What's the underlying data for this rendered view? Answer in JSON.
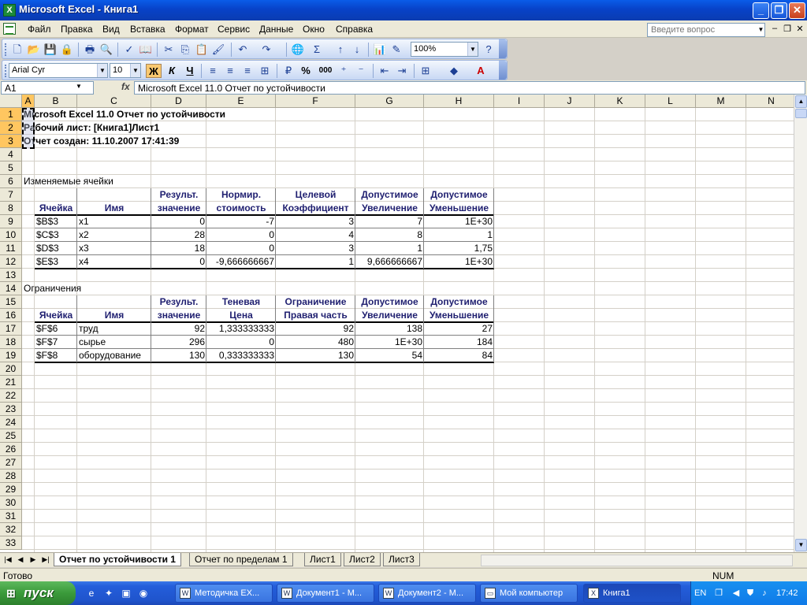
{
  "window": {
    "title": "Microsoft Excel - Книга1",
    "app_icon": "X",
    "buttons": [
      "_",
      "❐",
      "✕"
    ]
  },
  "menu": {
    "items": [
      "Файл",
      "Правка",
      "Вид",
      "Вставка",
      "Формат",
      "Сервис",
      "Данные",
      "Окно",
      "Справка"
    ],
    "help_placeholder": "Введите вопрос",
    "mdi_buttons": [
      "–",
      "❐",
      "✕"
    ]
  },
  "toolbar_standard": {
    "zoom": "100%",
    "icons": [
      "new-icon",
      "open-icon",
      "save-icon",
      "permission-icon",
      "print-icon",
      "print-preview-icon",
      "spelling-icon",
      "research-icon",
      "cut-icon",
      "copy-icon",
      "paste-icon",
      "format-painter-icon",
      "undo-icon",
      "redo-icon",
      "hyperlink-icon",
      "autosum-icon",
      "sort-asc-icon",
      "sort-desc-icon",
      "chart-wizard-icon",
      "drawing-icon",
      "help-icon"
    ]
  },
  "toolbar_formatting": {
    "font": "Arial Cyr",
    "size": "10",
    "bold": "Ж",
    "italic": "К",
    "underline": "Ч",
    "percent": "%",
    "thousands": "000"
  },
  "formula_bar": {
    "name_box": "A1",
    "fx": "fx",
    "formula": "Microsoft Excel 11.0 Отчет по устойчивости"
  },
  "columns": [
    "A",
    "B",
    "C",
    "D",
    "E",
    "F",
    "G",
    "H",
    "I",
    "J",
    "K",
    "L",
    "M",
    "N"
  ],
  "rows": [
    "1",
    "2",
    "3",
    "4",
    "5",
    "6",
    "7",
    "8",
    "9",
    "10",
    "11",
    "12",
    "13",
    "14",
    "15",
    "16",
    "17",
    "18",
    "19",
    "20",
    "21",
    "22",
    "23",
    "24",
    "25",
    "26",
    "27",
    "28",
    "29",
    "30",
    "31",
    "32",
    "33"
  ],
  "report": {
    "title1": "Microsoft Excel 11.0 Отчет по устойчивости",
    "title2": "Рабочий лист: [Книга1]Лист1",
    "title3": "Отчет создан: 11.10.2007 17:41:39",
    "section1": "Изменяемые ячейки",
    "section2": "Ограничения",
    "t1_head1": [
      "",
      "",
      "Результ.",
      "Нормир.",
      "Целевой",
      "Допустимое",
      "Допустимое"
    ],
    "t1_head2": [
      "Ячейка",
      "Имя",
      "значение",
      "стоимость",
      "Коэффициент",
      "Увеличение",
      "Уменьшение"
    ],
    "t1_rows": [
      [
        "$B$3",
        "x1",
        "0",
        "-7",
        "3",
        "7",
        "1E+30"
      ],
      [
        "$C$3",
        "x2",
        "28",
        "0",
        "4",
        "8",
        "1"
      ],
      [
        "$D$3",
        "x3",
        "18",
        "0",
        "3",
        "1",
        "1,75"
      ],
      [
        "$E$3",
        "x4",
        "0",
        "-9,666666667",
        "1",
        "9,666666667",
        "1E+30"
      ]
    ],
    "t2_head1": [
      "",
      "",
      "Результ.",
      "Теневая",
      "Ограничение",
      "Допустимое",
      "Допустимое"
    ],
    "t2_head2": [
      "Ячейка",
      "Имя",
      "значение",
      "Цена",
      "Правая часть",
      "Увеличение",
      "Уменьшение"
    ],
    "t2_rows": [
      [
        "$F$6",
        "труд",
        "92",
        "1,333333333",
        "92",
        "138",
        "27"
      ],
      [
        "$F$7",
        "сырье",
        "296",
        "0",
        "480",
        "1E+30",
        "184"
      ],
      [
        "$F$8",
        "оборудование",
        "130",
        "0,333333333",
        "130",
        "54",
        "84"
      ]
    ]
  },
  "sheet_tabs": [
    "Отчет по устойчивости 1",
    "Отчет по пределам 1",
    "Лист1",
    "Лист2",
    "Лист3"
  ],
  "status": {
    "text": "Готово",
    "num": "NUM"
  },
  "taskbar": {
    "start": "пуск",
    "tasks": [
      "Методичка EX...",
      "Документ1 - М...",
      "Документ2 - М...",
      "Мой компьютер",
      "Книга1"
    ],
    "lang": "EN",
    "clock": "17:42"
  }
}
